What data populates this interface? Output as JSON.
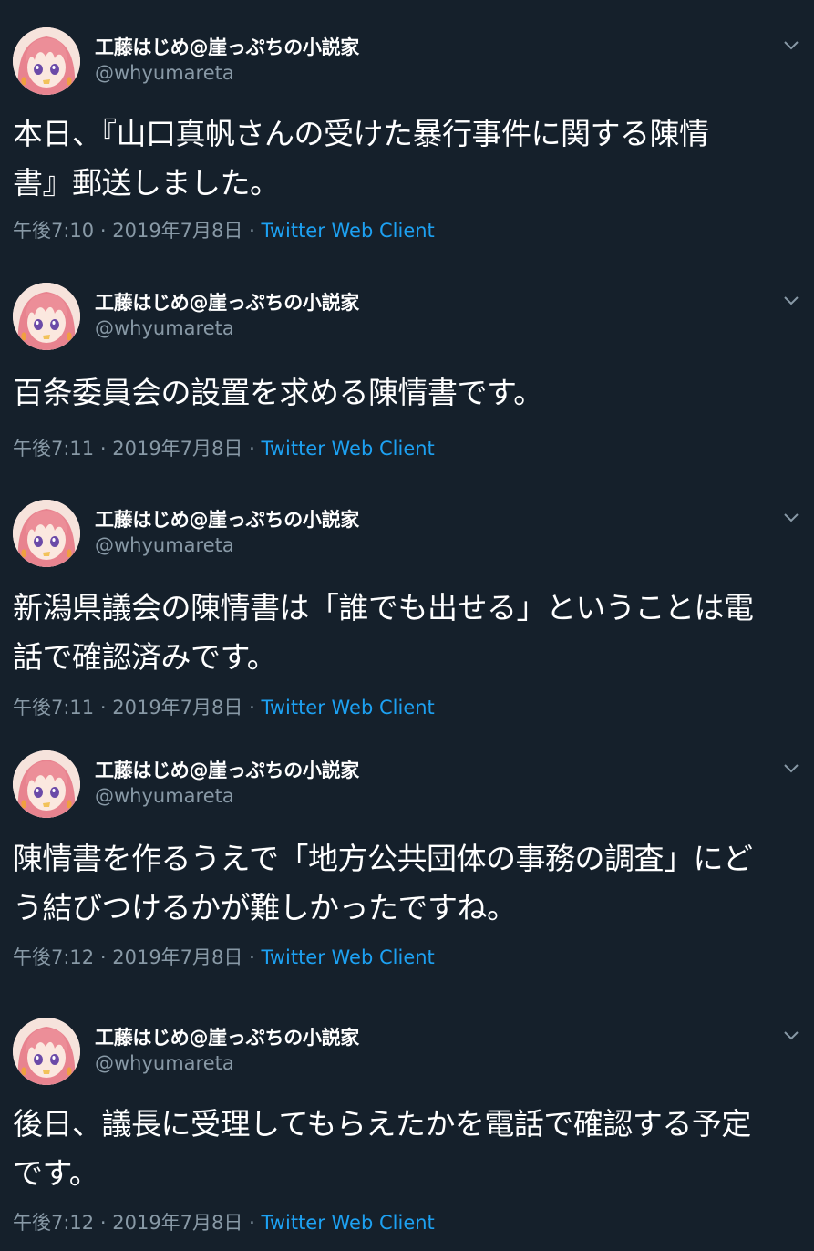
{
  "colors": {
    "background": "#15202b",
    "text": "#ffffff",
    "secondary": "#8899a6",
    "link": "#1da1f2"
  },
  "tweets": [
    {
      "author_name": "工藤はじめ@崖っぷちの小説家",
      "handle": "@whyumareta",
      "lines": [
        "本日、『山口真帆さんの受けた暴行事件に関する陳情",
        "書』郵送しました。"
      ],
      "time": "午後7:10",
      "date": "2019年7月8日",
      "client": "Twitter Web Client",
      "separator": "·"
    },
    {
      "author_name": "工藤はじめ@崖っぷちの小説家",
      "handle": "@whyumareta",
      "lines": [
        "百条委員会の設置を求める陳情書です。"
      ],
      "time": "午後7:11",
      "date": "2019年7月8日",
      "client": "Twitter Web Client",
      "separator": "·"
    },
    {
      "author_name": "工藤はじめ@崖っぷちの小説家",
      "handle": "@whyumareta",
      "lines": [
        "新潟県議会の陳情書は「誰でも出せる」ということは電",
        "話で確認済みです。"
      ],
      "time": "午後7:11",
      "date": "2019年7月8日",
      "client": "Twitter Web Client",
      "separator": "·"
    },
    {
      "author_name": "工藤はじめ@崖っぷちの小説家",
      "handle": "@whyumareta",
      "lines": [
        "陳情書を作るうえで「地方公共団体の事務の調査」にど",
        "う結びつけるかが難しかったですね。"
      ],
      "time": "午後7:12",
      "date": "2019年7月8日",
      "client": "Twitter Web Client",
      "separator": "·"
    },
    {
      "author_name": "工藤はじめ@崖っぷちの小説家",
      "handle": "@whyumareta",
      "lines": [
        "後日、議長に受理してもらえたかを電話で確認する予定",
        "です。"
      ],
      "time": "午後7:12",
      "date": "2019年7月8日",
      "client": "Twitter Web Client",
      "separator": "·"
    }
  ]
}
